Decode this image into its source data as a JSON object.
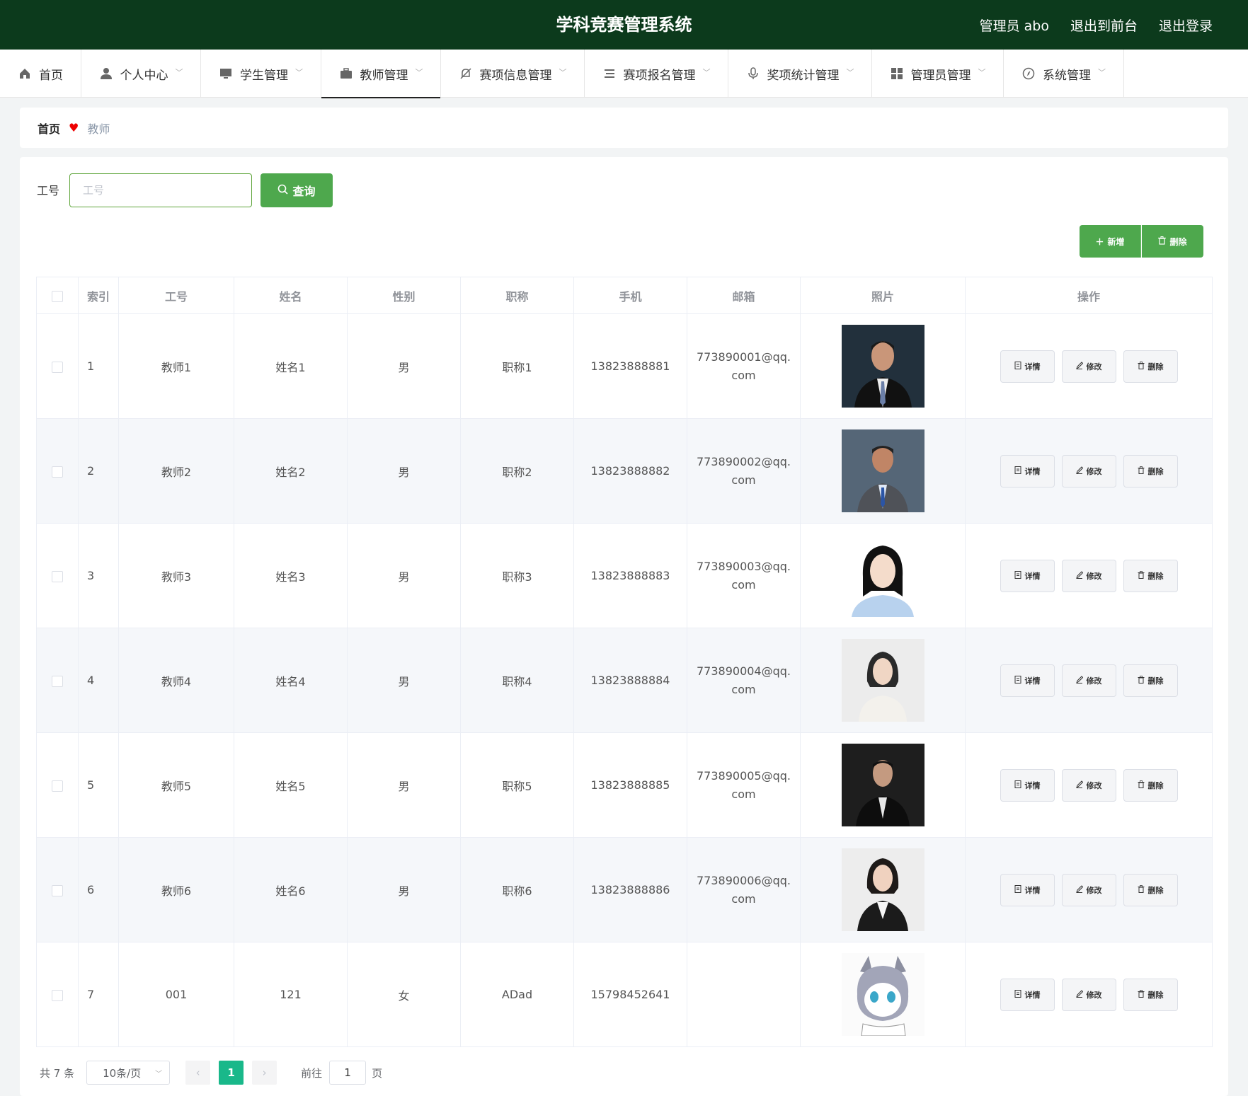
{
  "header": {
    "title": "学科竞赛管理系统",
    "admin": "管理员 abo",
    "to_front": "退出到前台",
    "logout": "退出登录"
  },
  "menu": [
    {
      "label": "首页",
      "icon": "home-icon",
      "dropdown": false
    },
    {
      "label": "个人中心",
      "icon": "user-icon",
      "dropdown": true
    },
    {
      "label": "学生管理",
      "icon": "monitor-icon",
      "dropdown": true
    },
    {
      "label": "教师管理",
      "icon": "briefcase-icon",
      "dropdown": true,
      "active": true
    },
    {
      "label": "赛项信息管理",
      "icon": "bell-off-icon",
      "dropdown": true
    },
    {
      "label": "赛项报名管理",
      "icon": "list-icon",
      "dropdown": true
    },
    {
      "label": "奖项统计管理",
      "icon": "microphone-icon",
      "dropdown": true
    },
    {
      "label": "管理员管理",
      "icon": "grid-icon",
      "dropdown": true
    },
    {
      "label": "系统管理",
      "icon": "compass-icon",
      "dropdown": true
    }
  ],
  "breadcrumb": {
    "home": "首页",
    "current": "教师"
  },
  "search": {
    "label": "工号",
    "placeholder": "工号",
    "button": "查询"
  },
  "actions": {
    "add": "新增",
    "delete": "删除"
  },
  "table": {
    "headers": {
      "index": "索引",
      "id": "工号",
      "name": "姓名",
      "gender": "性别",
      "title": "职称",
      "phone": "手机",
      "email": "邮箱",
      "photo": "照片",
      "ops": "操作"
    },
    "op_labels": {
      "detail": "详情",
      "edit": "修改",
      "delete": "删除"
    },
    "rows": [
      {
        "index": "1",
        "id": "教师1",
        "name": "姓名1",
        "gender": "男",
        "title": "职称1",
        "phone": "13823888881",
        "email": "773890001@qq.com"
      },
      {
        "index": "2",
        "id": "教师2",
        "name": "姓名2",
        "gender": "男",
        "title": "职称2",
        "phone": "13823888882",
        "email": "773890002@qq.com"
      },
      {
        "index": "3",
        "id": "教师3",
        "name": "姓名3",
        "gender": "男",
        "title": "职称3",
        "phone": "13823888883",
        "email": "773890003@qq.com"
      },
      {
        "index": "4",
        "id": "教师4",
        "name": "姓名4",
        "gender": "男",
        "title": "职称4",
        "phone": "13823888884",
        "email": "773890004@qq.com"
      },
      {
        "index": "5",
        "id": "教师5",
        "name": "姓名5",
        "gender": "男",
        "title": "职称5",
        "phone": "13823888885",
        "email": "773890005@qq.com"
      },
      {
        "index": "6",
        "id": "教师6",
        "name": "姓名6",
        "gender": "男",
        "title": "职称6",
        "phone": "13823888886",
        "email": "773890006@qq.com"
      },
      {
        "index": "7",
        "id": "001",
        "name": "121",
        "gender": "女",
        "title": "ADad",
        "phone": "15798452641",
        "email": ""
      }
    ]
  },
  "pagination": {
    "total": "共 7 条",
    "page_size": "10条/页",
    "current_page": "1",
    "goto": "前往",
    "goto_value": "1",
    "page_suffix": "页"
  }
}
